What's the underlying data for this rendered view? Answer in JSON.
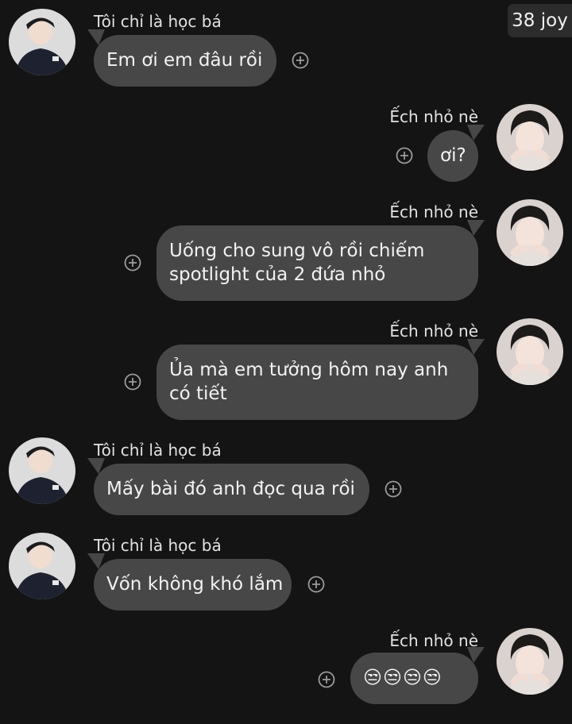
{
  "header": {
    "badge_label": "38 joy"
  },
  "senders": {
    "left": "Tôi chỉ là học bá",
    "right": "Ếch nhỏ nè"
  },
  "messages": [
    {
      "side": "left",
      "text": "Em ơi em đâu rồi"
    },
    {
      "side": "right",
      "text": "ơi?"
    },
    {
      "side": "right",
      "text": "Uống cho sung vô rồi chiếm spotlight của 2 đứa nhỏ"
    },
    {
      "side": "right",
      "text": "Ủa mà em tưởng hôm nay anh có tiết"
    },
    {
      "side": "left",
      "text": "Mấy bài đó anh đọc qua rồi"
    },
    {
      "side": "left",
      "text": "Vốn không khó lắm"
    },
    {
      "side": "right",
      "text": "😒😒😒😒"
    }
  ],
  "colors": {
    "background": "#141414",
    "bubble": "#474747",
    "badge": "#2c2c2c"
  },
  "icons": {
    "react_button": "plus-circle-icon"
  }
}
